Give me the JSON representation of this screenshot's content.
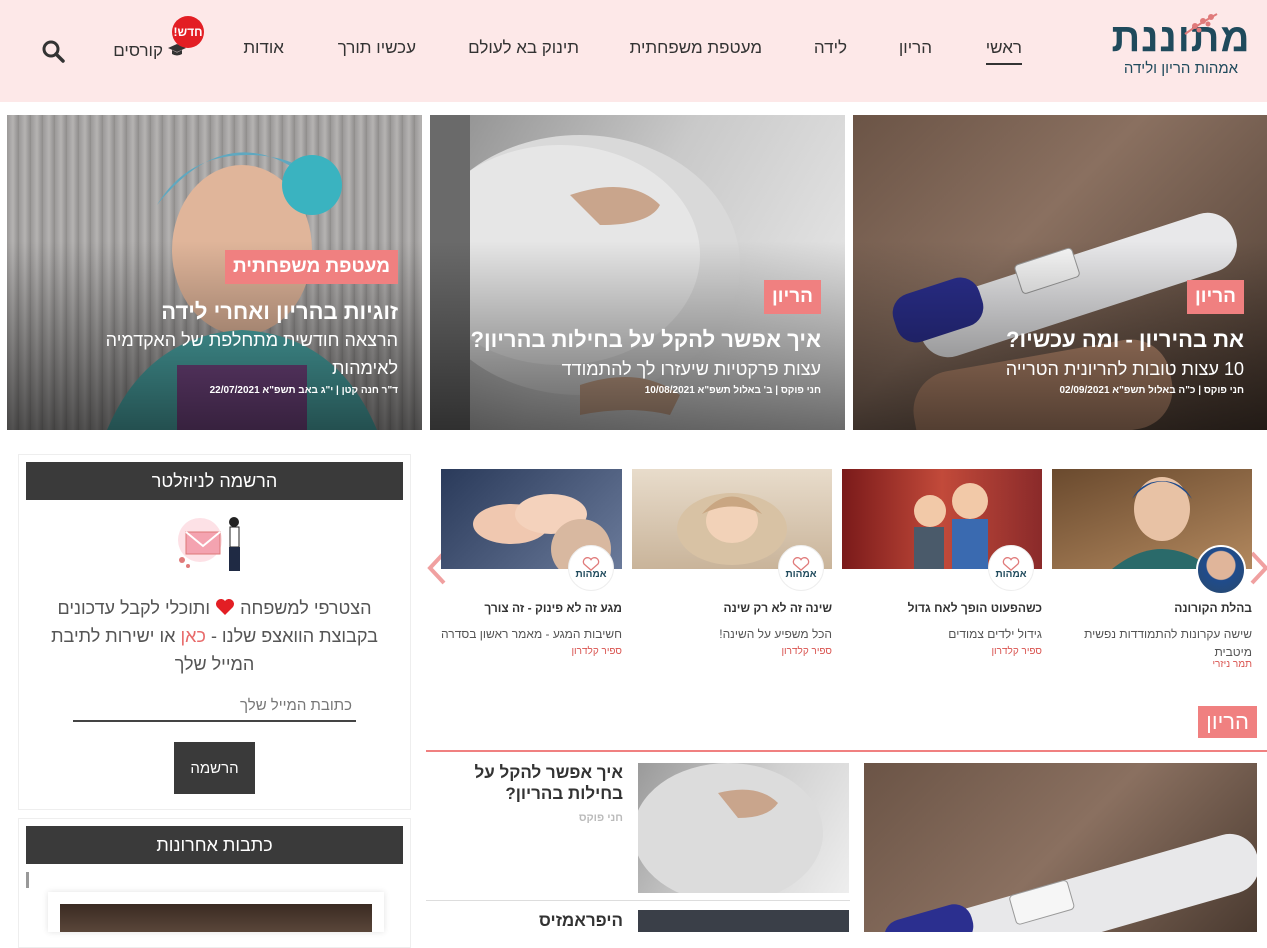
{
  "header": {
    "logo_text": "מתוננת",
    "logo_tagline": "אמהות הריון ולידה",
    "nav": [
      {
        "label": "ראשי",
        "active": true
      },
      {
        "label": "הריון"
      },
      {
        "label": "לידה"
      },
      {
        "label": "מעטפת משפחתית"
      },
      {
        "label": "תינוק בא לעולם"
      },
      {
        "label": "עכשיו תורך"
      },
      {
        "label": "אודות"
      },
      {
        "label": "קורסים"
      }
    ],
    "new_badge": "חדש!"
  },
  "hero": [
    {
      "category": "הריון",
      "title": "את בהיריון - ומה עכשיו?",
      "subtitle": "10 עצות טובות להריונית הטרייה",
      "meta": "חני פוקס | כ\"ה באלול תשפ\"א 02/09/2021"
    },
    {
      "category": "הריון",
      "title": "איך אפשר להקל על בחילות בהריון?",
      "subtitle": "עצות פרקטיות שיעזרו לך להתמודד",
      "meta": "חני פוקס | ב' באלול תשפ\"א 10/08/2021"
    },
    {
      "category": "מעטפת משפחתית",
      "title": "זוגיות בהריון ואחרי לידה",
      "subtitle": "הרצאה חודשית מתחלפת של האקדמיה לאימהות",
      "meta": "ד\"ר חנה קטן | י\"ג באב תשפ\"א 22/07/2021"
    }
  ],
  "newsletter": {
    "title": "הרשמה לניוזלטר",
    "text_before": "הצטרפי למשפחה",
    "text_after": "ותוכלי לקבל עדכונים בקבוצת הוואצפ שלנו -",
    "link": "כאן",
    "text_end": "או ישירות לתיבת המייל שלך",
    "email_placeholder": "כתובת המייל שלך",
    "button": "הרשמה"
  },
  "recent_posts": {
    "title": "כתבות אחרונות"
  },
  "carousel": [
    {
      "title": "בהלת הקורונה",
      "excerpt": "שישה עקרונות להתמודדות נפשית מיטבית",
      "author": "תמר ניזרי"
    },
    {
      "title": "כשהפעוט הופך לאח גדול",
      "excerpt": "גידול ילדים צמודים",
      "author": "ספיר קלדרון",
      "logo": "אמהות"
    },
    {
      "title": "שינה זה לא רק שינה",
      "excerpt": "הכל משפיע על השינה!",
      "author": "ספיר קלדרון",
      "logo": "אמהות"
    },
    {
      "title": "מגע זה לא פינוק - זה צורך",
      "excerpt": "חשיבות המגע - מאמר ראשון בסדרה",
      "author": "ספיר קלדרון",
      "logo": "אמהות"
    }
  ],
  "section": {
    "tag": "הריון",
    "list": [
      {
        "title": "איך אפשר להקל על בחילות בהריון?",
        "author": "חני פוקס"
      },
      {
        "title": "היפראמזיס"
      }
    ]
  },
  "colors": {
    "accent": "#f08080",
    "header_bg": "#fde8e8",
    "logo": "#1f4a5c",
    "dark": "#3a3a3a"
  }
}
